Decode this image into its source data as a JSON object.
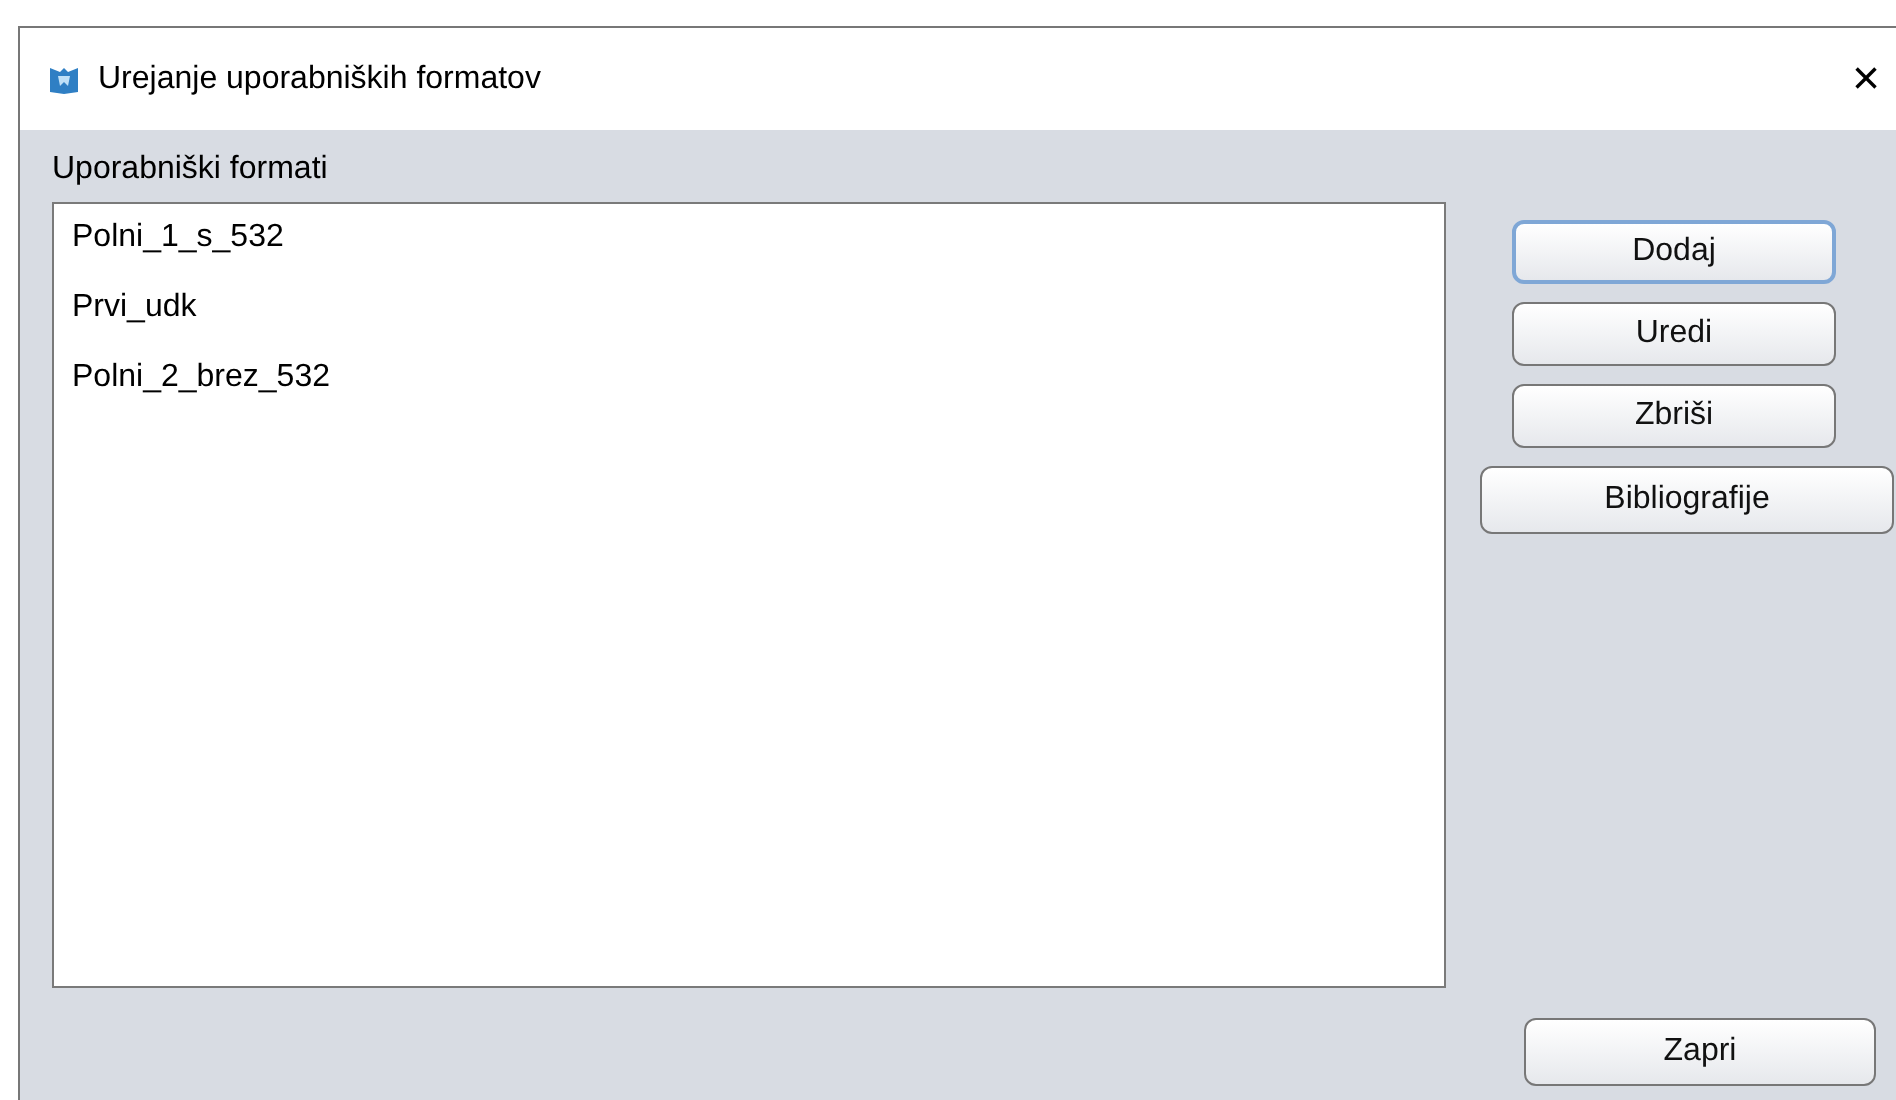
{
  "window": {
    "title": "Urejanje uporabniških formatov",
    "close": "×"
  },
  "list": {
    "label": "Uporabniški formati",
    "items": [
      {
        "text": "Polni_1_s_532",
        "selected": false
      },
      {
        "text": "Prvi_udk",
        "selected": false
      },
      {
        "text": "Polni_2_brez_532",
        "selected": false
      }
    ]
  },
  "buttons": [
    {
      "label": "Dodaj",
      "kind": "focused"
    },
    {
      "label": "Uredi",
      "kind": "normal"
    },
    {
      "label": "Zbriši",
      "kind": "normal"
    },
    {
      "label": "Bibliografije",
      "kind": "wide"
    }
  ],
  "footer_button": {
    "label": "Zapri"
  }
}
